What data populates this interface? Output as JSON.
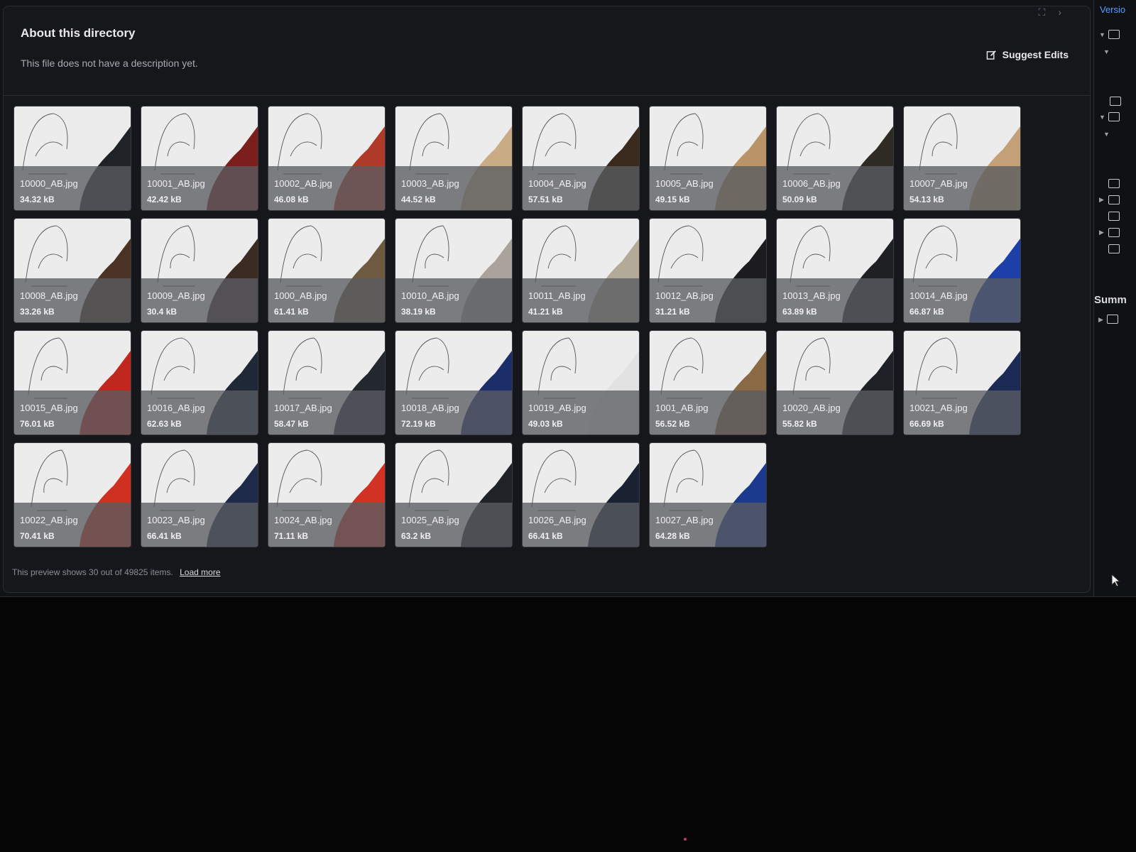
{
  "header": {
    "title": "About this directory",
    "description": "This file does not have a description yet.",
    "suggest_edits": "Suggest Edits"
  },
  "sidebar": {
    "version_label": "Versio",
    "summary_label": "Summ"
  },
  "files": [
    {
      "name": "10000_AB.jpg",
      "size": "34.32 kB",
      "color": "#1f2226"
    },
    {
      "name": "10001_AB.jpg",
      "size": "42.42 kB",
      "color": "#7a1f1c"
    },
    {
      "name": "10002_AB.jpg",
      "size": "46.08 kB",
      "color": "#b03a2a"
    },
    {
      "name": "10003_AB.jpg",
      "size": "44.52 kB",
      "color": "#c9ab85"
    },
    {
      "name": "10004_AB.jpg",
      "size": "57.51 kB",
      "color": "#3a2a1e"
    },
    {
      "name": "10005_AB.jpg",
      "size": "49.15 kB",
      "color": "#b89468"
    },
    {
      "name": "10006_AB.jpg",
      "size": "50.09 kB",
      "color": "#2e2a24"
    },
    {
      "name": "10007_AB.jpg",
      "size": "54.13 kB",
      "color": "#c4a078"
    },
    {
      "name": "10008_AB.jpg",
      "size": "33.26 kB",
      "color": "#4a3324"
    },
    {
      "name": "10009_AB.jpg",
      "size": "30.4 kB",
      "color": "#3b2b22"
    },
    {
      "name": "1000_AB.jpg",
      "size": "61.41 kB",
      "color": "#6e5a40"
    },
    {
      "name": "10010_AB.jpg",
      "size": "38.19 kB",
      "color": "#a9a39b"
    },
    {
      "name": "10011_AB.jpg",
      "size": "41.21 kB",
      "color": "#b4aa98"
    },
    {
      "name": "10012_AB.jpg",
      "size": "31.21 kB",
      "color": "#1c1c1e"
    },
    {
      "name": "10013_AB.jpg",
      "size": "63.89 kB",
      "color": "#1f2024"
    },
    {
      "name": "10014_AB.jpg",
      "size": "66.87 kB",
      "color": "#1d3fa8"
    },
    {
      "name": "10015_AB.jpg",
      "size": "76.01 kB",
      "color": "#c0281f"
    },
    {
      "name": "10016_AB.jpg",
      "size": "62.63 kB",
      "color": "#1e2836"
    },
    {
      "name": "10017_AB.jpg",
      "size": "58.47 kB",
      "color": "#23272e"
    },
    {
      "name": "10018_AB.jpg",
      "size": "72.19 kB",
      "color": "#1b2e6a"
    },
    {
      "name": "10019_AB.jpg",
      "size": "49.03 kB",
      "color": "#e2e2e2"
    },
    {
      "name": "1001_AB.jpg",
      "size": "56.52 kB",
      "color": "#8a6a44"
    },
    {
      "name": "10020_AB.jpg",
      "size": "55.82 kB",
      "color": "#1e2126"
    },
    {
      "name": "10021_AB.jpg",
      "size": "66.69 kB",
      "color": "#1a2a55"
    },
    {
      "name": "10022_AB.jpg",
      "size": "70.41 kB",
      "color": "#d0301f"
    },
    {
      "name": "10023_AB.jpg",
      "size": "66.41 kB",
      "color": "#1e2a4a"
    },
    {
      "name": "10024_AB.jpg",
      "size": "71.11 kB",
      "color": "#d23224"
    },
    {
      "name": "10025_AB.jpg",
      "size": "63.2 kB",
      "color": "#1f2226"
    },
    {
      "name": "10026_AB.jpg",
      "size": "66.41 kB",
      "color": "#1a2232"
    },
    {
      "name": "10027_AB.jpg",
      "size": "64.28 kB",
      "color": "#1b3a8e"
    }
  ],
  "footer": {
    "preview_text": "This preview shows 30 out of 49825 items.",
    "load_more": "Load more"
  }
}
